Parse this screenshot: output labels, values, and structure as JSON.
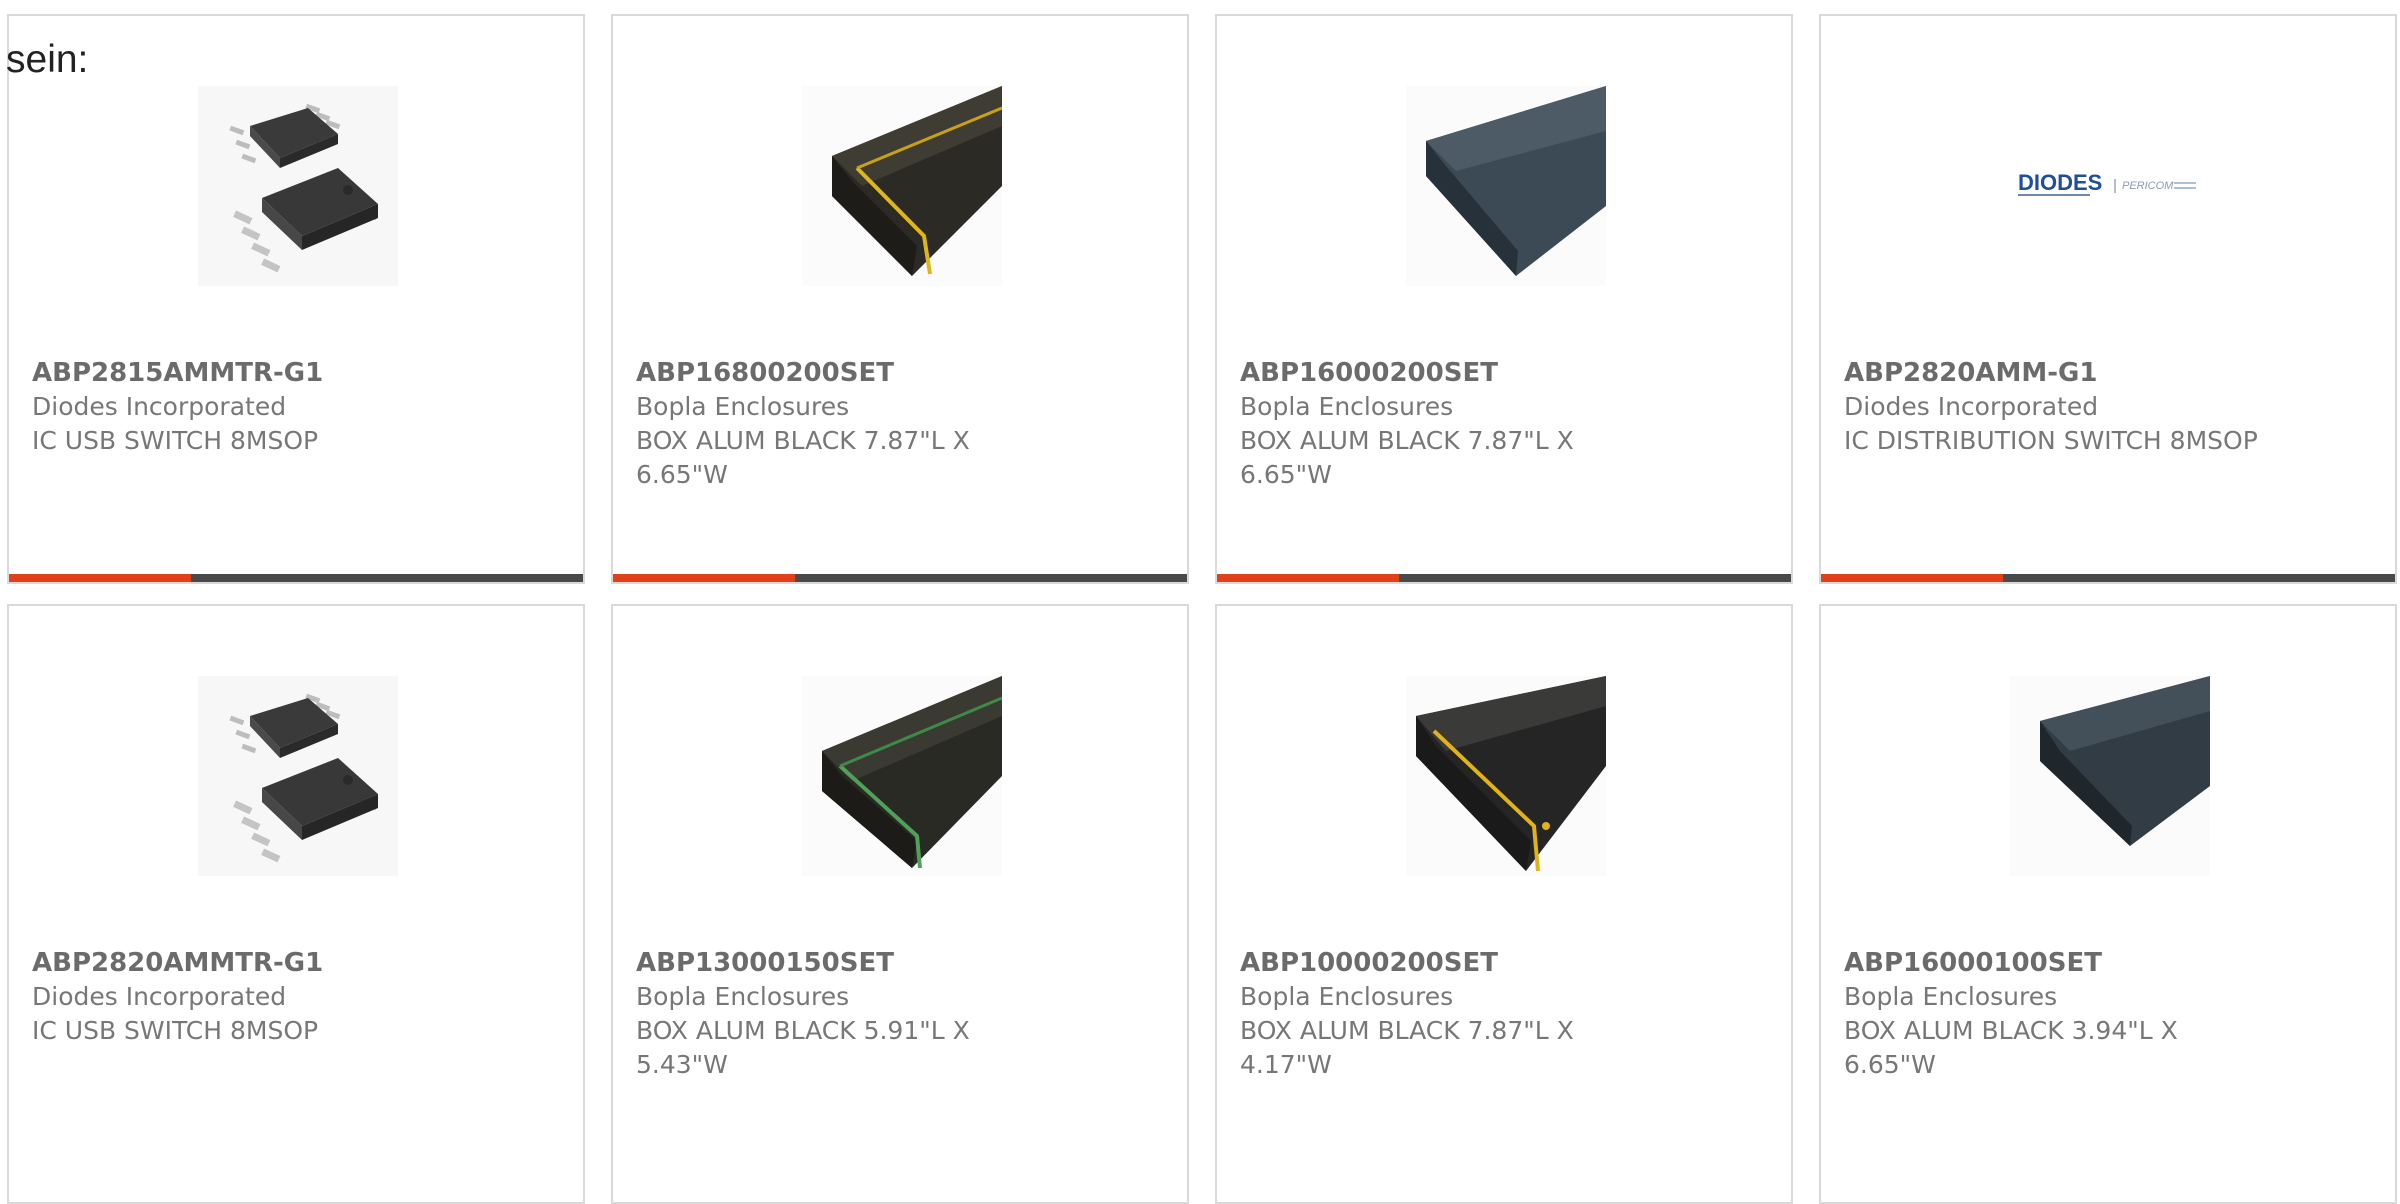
{
  "intro_text": "sein:",
  "colors": {
    "accent": "#e0401a",
    "bar_dark": "#4a4a4a",
    "border": "#d9d9d9",
    "text": "#777777"
  },
  "products": [
    {
      "part_number": "ABP2815AMMTR-G1",
      "manufacturer": "Diodes Incorporated",
      "description": "IC USB SWITCH 8MSOP",
      "image_icon": "ic-chip-icon"
    },
    {
      "part_number": "ABP16800200SET",
      "manufacturer": "Bopla Enclosures",
      "description": "BOX ALUM BLACK 7.87\"L X 6.65\"W",
      "image_icon": "enclosure-yellow-seal-icon"
    },
    {
      "part_number": "ABP16000200SET",
      "manufacturer": "Bopla Enclosures",
      "description": "BOX ALUM BLACK 7.87\"L X 6.65\"W",
      "image_icon": "enclosure-slate-icon"
    },
    {
      "part_number": "ABP2820AMM-G1",
      "manufacturer": "Diodes Incorporated",
      "description": "IC DISTRIBUTION SWITCH 8MSOP",
      "image_icon": "diodes-logo-icon"
    },
    {
      "part_number": "ABP2820AMMTR-G1",
      "manufacturer": "Diodes Incorporated",
      "description": "IC USB SWITCH 8MSOP",
      "image_icon": "ic-chip-icon"
    },
    {
      "part_number": "ABP13000150SET",
      "manufacturer": "Bopla Enclosures",
      "description": "BOX ALUM BLACK 5.91\"L X 5.43\"W",
      "image_icon": "enclosure-green-seal-icon"
    },
    {
      "part_number": "ABP10000200SET",
      "manufacturer": "Bopla Enclosures",
      "description": "BOX ALUM BLACK 7.87\"L X 4.17\"W",
      "image_icon": "enclosure-yellow-seal-icon"
    },
    {
      "part_number": "ABP16000100SET",
      "manufacturer": "Bopla Enclosures",
      "description": "BOX ALUM BLACK 3.94\"L X 6.65\"W",
      "image_icon": "enclosure-slate-icon"
    }
  ],
  "logo_text": {
    "brand": "DIODES",
    "sub": "PERICOM"
  }
}
